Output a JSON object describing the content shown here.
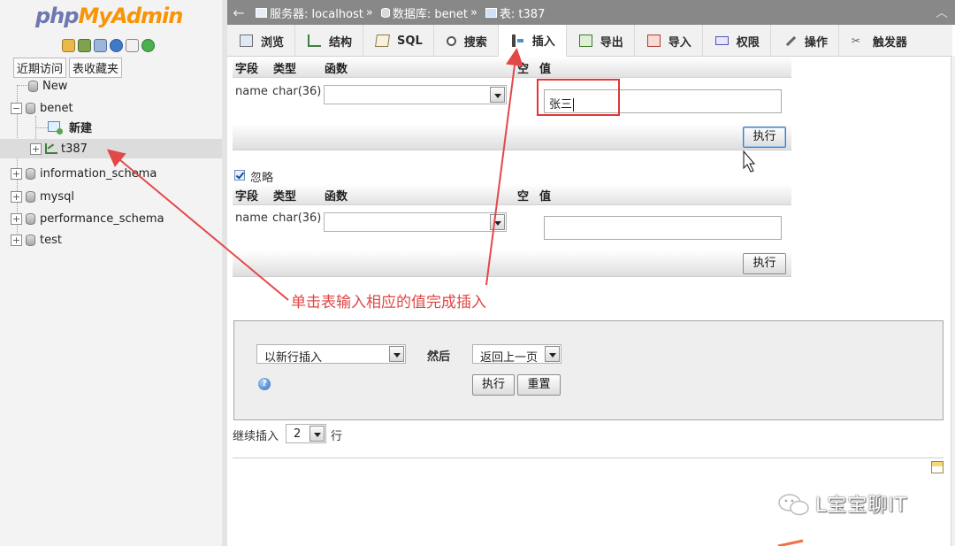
{
  "nav": {
    "logo_php": "php",
    "logo_myadmin": "MyAdmin",
    "tabs": [
      "近期访问",
      "表收藏夹"
    ],
    "tree": {
      "new": "New",
      "benet": "benet",
      "benet_new": "新建",
      "t387": "t387",
      "information_schema": "information_schema",
      "mysql": "mysql",
      "performance_schema": "performance_schema",
      "test": "test"
    }
  },
  "breadcrumb": {
    "server_label": "服务器: localhost",
    "db_label": "数据库: benet",
    "table_label": "表: t387",
    "sep": "»"
  },
  "tabs": [
    "浏览",
    "结构",
    "SQL",
    "搜索",
    "插入",
    "导出",
    "导入",
    "权限",
    "操作",
    "触发器"
  ],
  "active_tab": "插入",
  "form": {
    "col_field": "字段",
    "col_type": "类型",
    "col_function": "函数",
    "col_null": "空",
    "col_value": "值",
    "row_name": "name",
    "row_type": "char(36)",
    "value1": "张三",
    "value2": "",
    "execute": "执行",
    "ignore_label": "忽略"
  },
  "options": {
    "insert_mode": "以新行插入",
    "then_label": "然后",
    "after_action": "返回上一页",
    "execute": "执行",
    "reset": "重置",
    "help_icon_glyph": "?",
    "continue_label": "继续插入",
    "continue_count": "2",
    "rows_label": "行"
  },
  "annotation": {
    "text": "单击表输入相应的值完成插入",
    "color": "#e04646"
  },
  "watermark": "L宝宝聊IT",
  "colors": {
    "topbar": "#888888",
    "logo_php": "#6c78af",
    "logo_myadmin": "#f89406",
    "annotation_red": "#e03737"
  }
}
